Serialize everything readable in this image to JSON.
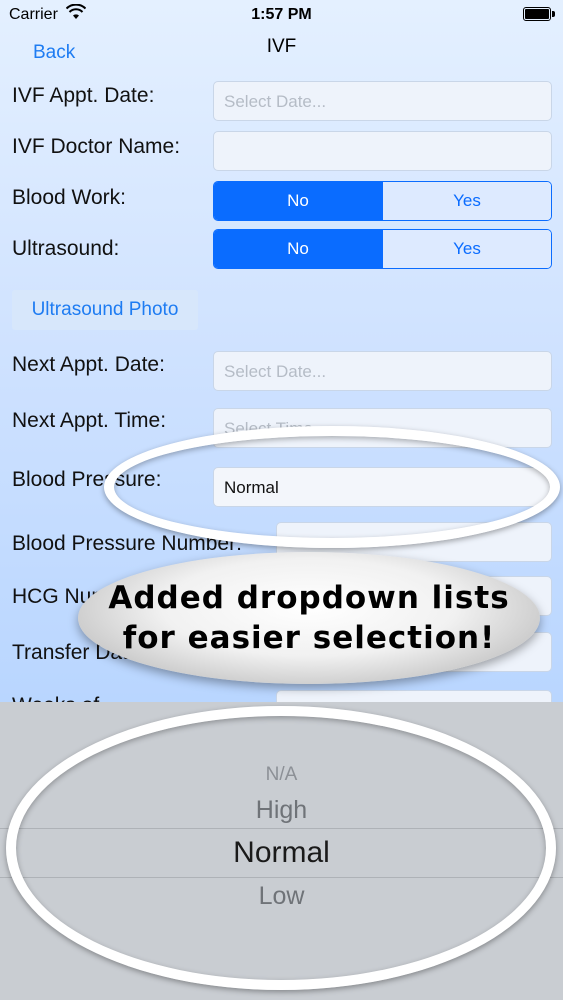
{
  "status_bar": {
    "carrier": "Carrier",
    "time": "1:57 PM"
  },
  "nav": {
    "back_label": "Back",
    "title": "IVF"
  },
  "form": {
    "ivf_appt_date": {
      "label": "IVF Appt. Date:",
      "placeholder": "Select Date..."
    },
    "ivf_doctor_name": {
      "label": "IVF Doctor Name:"
    },
    "blood_work": {
      "label": "Blood Work:",
      "options": [
        "No",
        "Yes"
      ],
      "selected": "No"
    },
    "ultrasound": {
      "label": "Ultrasound:",
      "options": [
        "No",
        "Yes"
      ],
      "selected": "No"
    },
    "ultrasound_photo_label": "Ultrasound Photo",
    "next_appt_date": {
      "label": "Next Appt. Date:",
      "placeholder": "Select Date..."
    },
    "next_appt_time": {
      "label": "Next Appt. Time:",
      "placeholder": "Select Time..."
    },
    "blood_pressure": {
      "label": "Blood Pressure:",
      "value": "Normal"
    },
    "blood_pressure_number": {
      "label": "Blood Pressure Number:"
    },
    "hcg_number": {
      "label": "HCG Number:"
    },
    "transfer_date": {
      "label": "Transfer Date:"
    },
    "weeks": {
      "label": "Weeks of"
    }
  },
  "callout": {
    "line1": "Added dropdown lists",
    "line2": "for easier selection!"
  },
  "picker": {
    "options": [
      "N/A",
      "High",
      "Normal",
      "Low"
    ],
    "selected": "Normal"
  },
  "colors": {
    "accent": "#0a6cff",
    "link": "#1e7cf2",
    "picker_bg": "#c9cdd2"
  }
}
